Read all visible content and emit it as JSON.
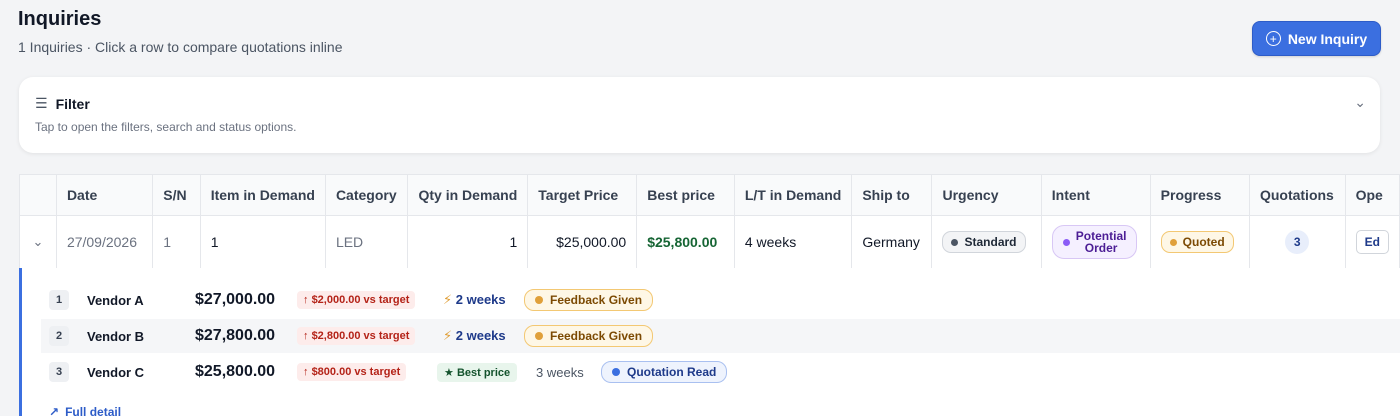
{
  "header": {
    "title": "Inquiries",
    "subtitle": "1 Inquiries · Click a row to compare quotations inline",
    "new_button_label": "New Inquiry",
    "new_button_icon": "plus-circle-icon"
  },
  "filter": {
    "title": "Filter",
    "hint": "Tap to open the filters, search and status options.",
    "icon": "sliders-icon",
    "chevron": "chevron-down-icon"
  },
  "table": {
    "columns": [
      "Date",
      "S/N",
      "Item in Demand",
      "Category",
      "Qty in Demand",
      "Target Price",
      "Best price",
      "L/T in Demand",
      "Ship to",
      "Urgency",
      "Intent",
      "Progress",
      "Quotations",
      "Ope"
    ],
    "row": {
      "date": "27/09/2026",
      "sn": "1",
      "item": "1",
      "category": "LED",
      "qty": "1",
      "target_price": "$25,000.00",
      "best_price": "$25,800.00",
      "lead_time": "4 weeks",
      "ship_to": "Germany",
      "urgency": "Standard",
      "intent_line1": "Potential",
      "intent_line2": "Order",
      "progress": "Quoted",
      "quotations": "3",
      "action": "Ed"
    }
  },
  "quotes": [
    {
      "num": "1",
      "vendor": "Vendor A",
      "price": "$27,000.00",
      "diff": "$2,000.00 vs target",
      "lead": "2 weeks",
      "status": "Feedback Given"
    },
    {
      "num": "2",
      "vendor": "Vendor B",
      "price": "$27,800.00",
      "diff": "$2,800.00 vs target",
      "lead": "2 weeks",
      "status": "Feedback Given"
    },
    {
      "num": "3",
      "vendor": "Vendor C",
      "price": "$25,800.00",
      "diff": "$800.00 vs target",
      "badge": "Best price",
      "lead": "3 weeks",
      "status": "Quotation Read"
    }
  ],
  "full_detail_label": "Full detail",
  "colors": {
    "accent": "#3b6fe0",
    "best_price": "#166534",
    "diff_red": "#b42318",
    "standard_dot": "#4b5563",
    "intent_dot": "#8b5cf6",
    "quoted_dot": "#e0a03a",
    "feedback_dot": "#e0a03a",
    "read_dot": "#3b6fe0"
  }
}
